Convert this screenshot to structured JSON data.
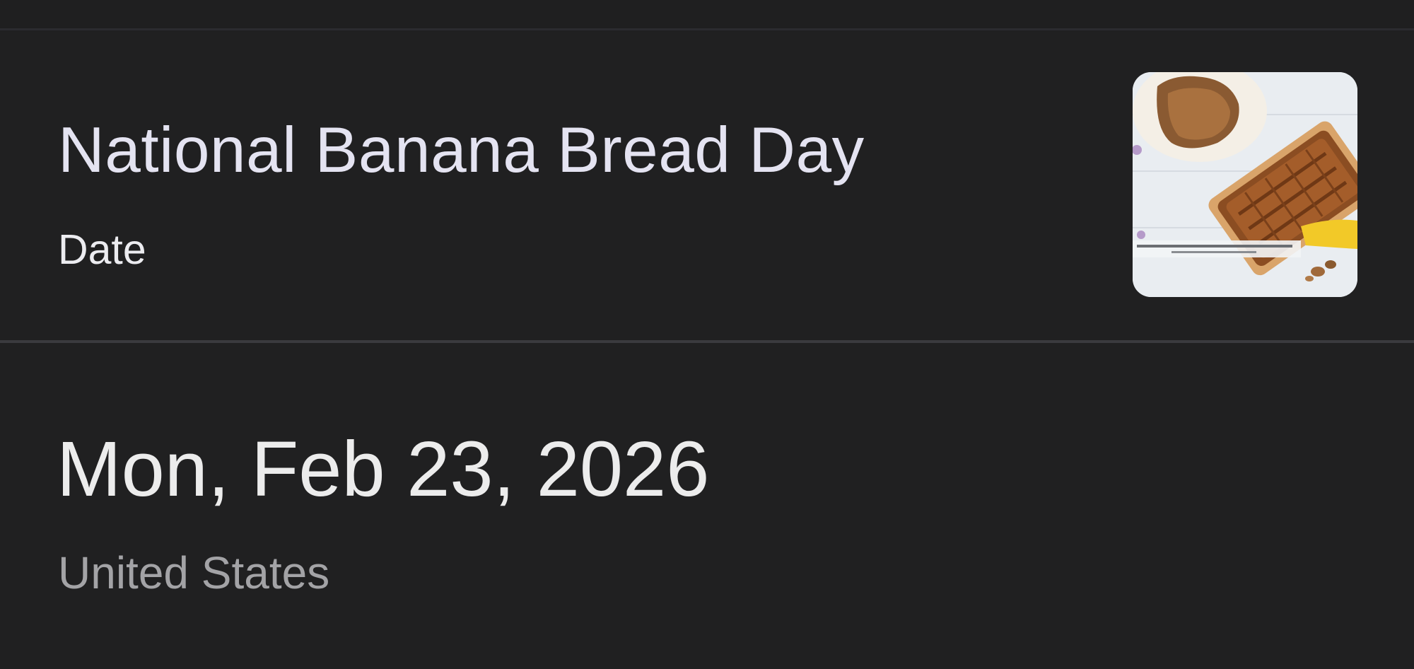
{
  "event": {
    "title": "National Banana Bread Day",
    "type_label": "Date",
    "thumbnail_icon": "banana-bread-photo"
  },
  "details": {
    "date": "Mon, Feb 23, 2026",
    "region": "United States"
  },
  "colors": {
    "background": "#202021",
    "title_text": "#e4e3f1",
    "secondary_text": "#a3a3a6",
    "divider": "#3a3a3e"
  }
}
